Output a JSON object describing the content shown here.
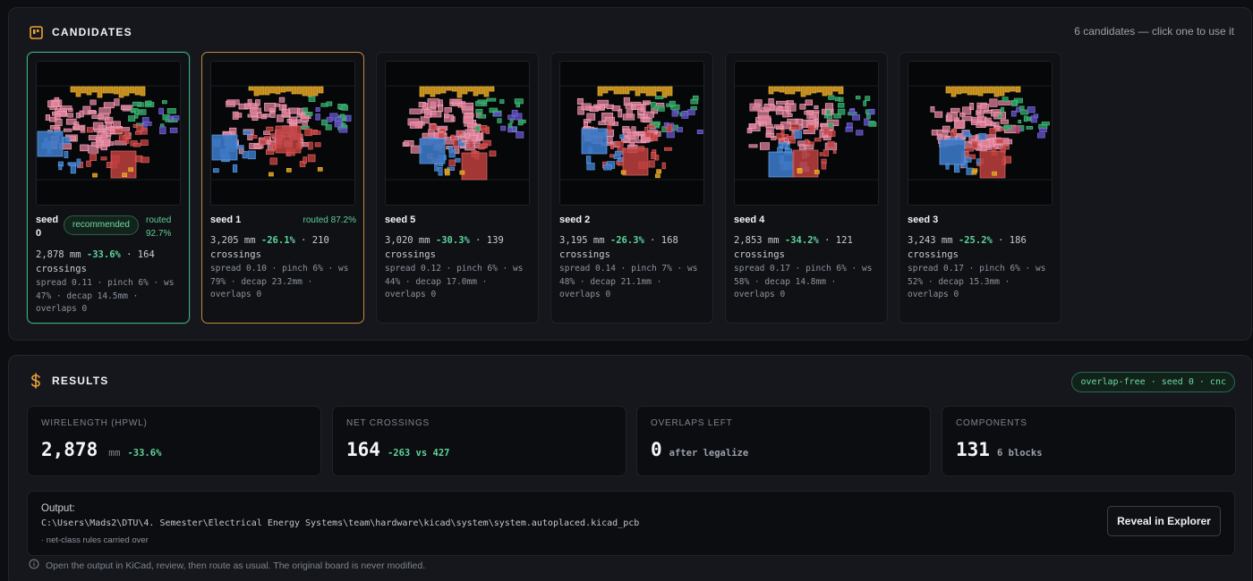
{
  "candidates": {
    "title": "CANDIDATES",
    "hint": "6 candidates — click one to use it",
    "icon": "board-icon",
    "items": [
      {
        "seed": "seed 0",
        "recommended": "recommended",
        "routed": "routed 92.7%",
        "stats_pre": "2,878 mm ",
        "pct": "-33.6%",
        "stats_post": " · 164 crossings",
        "detail": "spread 0.11 · pinch 6% · ws 47% · decap 14.5mm · overlaps 0",
        "state": "selected"
      },
      {
        "seed": "seed 1",
        "routed": "routed 87.2%",
        "stats_pre": "3,205 mm ",
        "pct": "-26.1%",
        "stats_post": " · 210 crossings",
        "detail": "spread 0.10 · pinch 6% · ws 79% · decap 23.2mm · overlaps 0",
        "state": "hover"
      },
      {
        "seed": "seed 5",
        "stats_pre": "3,020 mm ",
        "pct": "-30.3%",
        "stats_post": " · 139 crossings",
        "detail": "spread 0.12 · pinch 6% · ws 44% · decap 17.0mm · overlaps 0"
      },
      {
        "seed": "seed 2",
        "stats_pre": "3,195 mm ",
        "pct": "-26.3%",
        "stats_post": " · 168 crossings",
        "detail": "spread 0.14 · pinch 7% · ws 48% · decap 21.1mm · overlaps 0"
      },
      {
        "seed": "seed 4",
        "stats_pre": "2,853 mm ",
        "pct": "-34.2%",
        "stats_post": " · 121 crossings",
        "detail": "spread 0.17 · pinch 6% · ws 58% · decap 14.8mm · overlaps 0"
      },
      {
        "seed": "seed 3",
        "stats_pre": "3,243 mm ",
        "pct": "-25.2%",
        "stats_post": " · 186 crossings",
        "detail": "spread 0.17 · pinch 6% · ws 52% · decap 15.3mm · overlaps 0"
      }
    ]
  },
  "results": {
    "title": "RESULTS",
    "icon": "dollar-icon",
    "badge": "overlap-free · seed 0 · cnc",
    "metrics": {
      "wirelength": {
        "label": "WIRELENGTH (HPWL)",
        "value": "2,878",
        "unit": "mm",
        "sub": "-33.6%"
      },
      "crossings": {
        "label": "NET CROSSINGS",
        "value": "164",
        "sub": "-263 vs 427"
      },
      "overlaps": {
        "label": "OVERLAPS LEFT",
        "value": "0",
        "sub": "after legalize"
      },
      "components": {
        "label": "COMPONENTS",
        "value": "131",
        "sub": "6 blocks"
      }
    },
    "output": {
      "label": "Output:",
      "path": "C:\\Users\\Mads2\\DTU\\4. Semester\\Electrical Energy Systems\\team\\hardware\\kicad\\system\\system.autoplaced.kicad_pcb",
      "note": "· net-class rules carried over",
      "button": "Reveal in Explorer"
    },
    "footer": "Open the output in KiCad, review, then route as usual. The original board is never modified."
  },
  "colors": {
    "accent_green": "#5fd39a",
    "accent_orange": "#c28a3a",
    "pink": "#e0809a",
    "blue": "#3b78c4",
    "red": "#c0403e",
    "gold": "#d69a1c",
    "green": "#2f9a5e",
    "purple": "#5a4bb6"
  }
}
